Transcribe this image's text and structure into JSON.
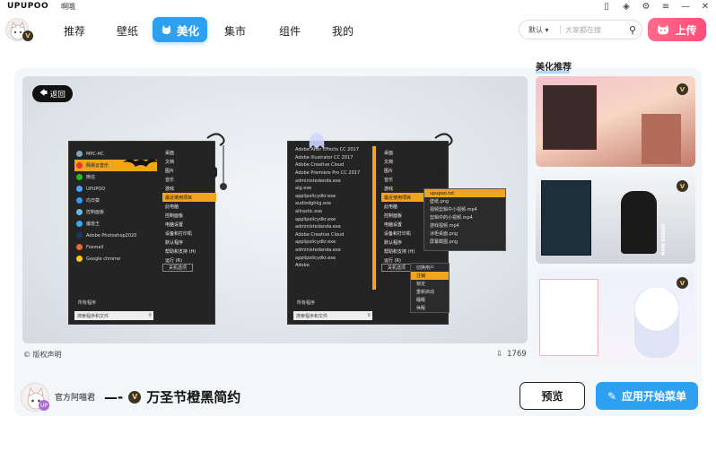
{
  "app": {
    "logo": "UPUPOO",
    "subtitle": "啊哦"
  },
  "nav": {
    "tabs": [
      "推荐",
      "壁纸",
      "美化",
      "集市",
      "组件",
      "我的"
    ],
    "active_tab": "美化"
  },
  "search": {
    "scope": "默认",
    "placeholder": "大家都在搜"
  },
  "upload_label": "上传",
  "preview": {
    "back_label": "返回",
    "copyright": "版权声明",
    "downloads": "1769"
  },
  "menu_left": {
    "items": [
      "MPC-HC",
      "网易云音乐",
      "微信",
      "UPUPOO",
      "向日葵",
      "控制面板",
      "魔兽王",
      "Adobe Photoshop2020",
      "Foxmail",
      "Google chrome"
    ],
    "right_items": [
      "桌面",
      "文档",
      "图片",
      "音乐",
      "游戏",
      "最近使用项目",
      "此电脑",
      "控制面板",
      "电脑设置",
      "设备和打印机",
      "默认程序",
      "帮助和支持 (H)",
      "运行 (R)"
    ],
    "all_programs": "所有程序",
    "search_placeholder": "搜索程序和文件",
    "power_label": "关机选项"
  },
  "menu_right": {
    "items": [
      "Adobe After Effects CC 2017",
      "Adobe Illustrator CC 2017",
      "Adobe Creative Cloud",
      "Adobe Premiere Pro CC 2017",
      "administedanda.exe",
      "alg.exe",
      "applipolicydkr.exe",
      "audiodghkg.exe",
      "allrastic.exe",
      "applipolicydkr.exe",
      "administedanda.exe",
      "Adobe Creative Cloud",
      "applipolicydkr.exe",
      "administedanda.exe",
      "applipolicydkr.exe",
      "Adobe"
    ],
    "right_items": [
      "桌面",
      "文档",
      "图片",
      "音乐",
      "游戏",
      "最近使用项目",
      "此电脑",
      "控制面板",
      "电脑设置",
      "设备和打印机",
      "默认程序",
      "帮助和支持 (H)",
      "运行 (R)"
    ],
    "recent_items": [
      "upupoo.txt",
      "壁纸.png",
      "视频剪辑中小视频.mp4",
      "剪辑中的小视频.mp4",
      "游戏视频.mp4",
      "冰柜桌面.png",
      "屏幕截图.png"
    ],
    "power_items": [
      "切换用户",
      "注销",
      "锁定",
      "重新启动",
      "睡眠",
      "休眠"
    ],
    "all_programs": "所有程序",
    "search_placeholder": "搜索程序和文件",
    "power_label": "关机选项"
  },
  "recommend": {
    "title": "美化推荐",
    "vip": "V",
    "thumb2_caption": "SPIDER-MAN"
  },
  "author": {
    "name": "官方阿喵君",
    "badge": "UP"
  },
  "theme": {
    "title": "万圣节橙黑简约",
    "prefix": "—-"
  },
  "buttons": {
    "preview": "预览",
    "apply": "应用开始菜单"
  },
  "colors": {
    "accent": "#2ea0f2",
    "upload": "#ff4d78",
    "menu_orange": "#f0a51c",
    "menu_bg": "#242424"
  }
}
